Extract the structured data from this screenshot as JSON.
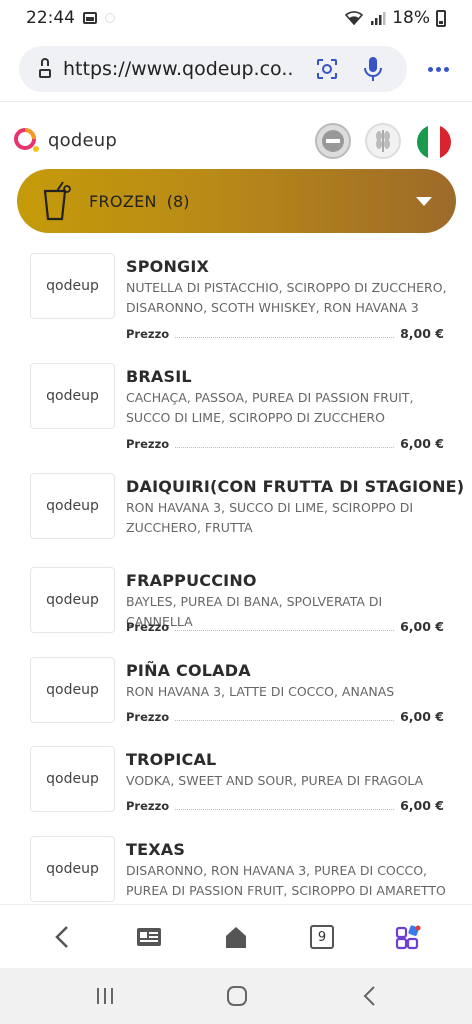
{
  "status": {
    "time": "22:44",
    "battery": "18%"
  },
  "browser": {
    "url": "https://www.qodeup.co...",
    "tabs_count": "9"
  },
  "app": {
    "logo_text": "qodeup"
  },
  "category": {
    "label": "FROZEN",
    "count": "(8)",
    "accent": "#c59b0a"
  },
  "items": [
    {
      "name": "SPONGIX",
      "desc": "NUTELLA DI PISTACCHIO, SCIROPPO DI ZUCCHERO, DISARONNO, SCOTH WHISKEY, RON HAVANA 3",
      "price_label": "Prezzo",
      "price": "8,00 €",
      "thumb": "qodeup"
    },
    {
      "name": "BRASIL",
      "desc": "CACHAÇA, PASSOA, PUREA DI PASSION FRUIT, SUCCO DI LIME, SCIROPPO DI ZUCCHERO",
      "price_label": "Prezzo",
      "price": "6,00 €",
      "thumb": "qodeup"
    },
    {
      "name": "DAIQUIRI(CON FRUTTA DI STAGIONE)",
      "desc": "RON HAVANA 3, SUCCO DI LIME, SCIROPPO DI ZUCCHERO, FRUTTA",
      "thumb": "qodeup"
    },
    {
      "name": "FRAPPUCCINO",
      "desc": "BAYLES, PUREA DI BANA, SPOLVERATA DI CANNELLA",
      "price_label": "Prezzo",
      "price": "6,00 €",
      "thumb": "qodeup"
    },
    {
      "name": "PIÑA COLADA",
      "desc": "RON HAVANA 3, LATTE DI COCCO, ANANAS",
      "price_label": "Prezzo",
      "price": "6,00 €",
      "thumb": "qodeup"
    },
    {
      "name": "TROPICAL",
      "desc": "VODKA, SWEET AND SOUR, PUREA DI FRAGOLA",
      "price_label": "Prezzo",
      "price": "6,00 €",
      "thumb": "qodeup"
    },
    {
      "name": "TEXAS",
      "desc": "DISARONNO, RON HAVANA 3, PUREA DI COCCO, PUREA DI PASSION FRUIT, SCIROPPO DI AMARETTO",
      "thumb": "qodeup"
    }
  ]
}
